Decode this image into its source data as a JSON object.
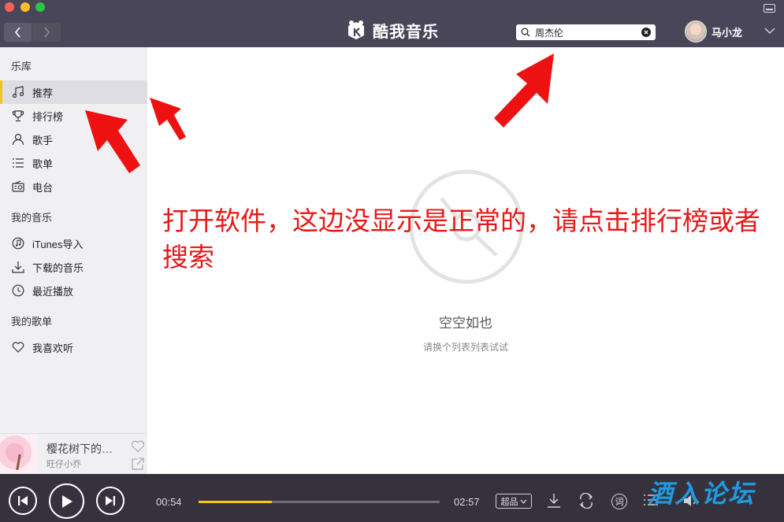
{
  "app": {
    "title": "酷我音乐"
  },
  "search": {
    "value": "周杰伦"
  },
  "user": {
    "name": "马小龙"
  },
  "sidebar": {
    "sections": [
      {
        "title": "乐库"
      },
      {
        "title": "我的音乐"
      },
      {
        "title": "我的歌单"
      }
    ],
    "items": [
      {
        "label": "推荐",
        "icon": "music-note-icon"
      },
      {
        "label": "排行榜",
        "icon": "trophy-icon"
      },
      {
        "label": "歌手",
        "icon": "person-icon"
      },
      {
        "label": "歌单",
        "icon": "list-icon"
      },
      {
        "label": "电台",
        "icon": "radio-icon"
      },
      {
        "label": "iTunes导入",
        "icon": "itunes-icon"
      },
      {
        "label": "下载的音乐",
        "icon": "download-icon"
      },
      {
        "label": "最近播放",
        "icon": "clock-icon"
      },
      {
        "label": "我喜欢听",
        "icon": "heart-icon"
      }
    ]
  },
  "now_playing": {
    "title": "樱花树下的…",
    "artist": "旺仔小乔"
  },
  "main": {
    "empty_title": "空空如也",
    "empty_subtitle": "请换个列表列表试试",
    "annotation": "打开软件，这边没显示是正常的，请点击排行榜或者搜索"
  },
  "player": {
    "current_time": "00:54",
    "total_time": "02:57",
    "progress": 0.305,
    "quality": "超品",
    "lyric_label": "词"
  },
  "watermark": "酒入论坛",
  "colors": {
    "titlebar": "#4a4659",
    "accent": "#f5c815",
    "annotation": "#e61919",
    "player_bg": "#35323d"
  }
}
